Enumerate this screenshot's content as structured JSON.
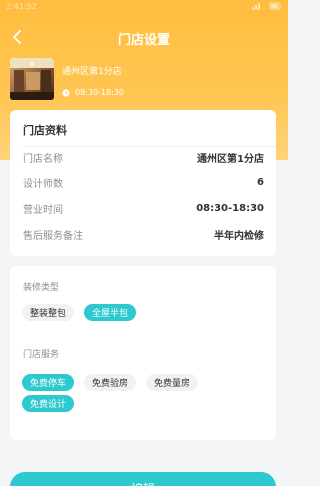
{
  "statusbar": {
    "time": "2:41:52",
    "icons": "signal-wifi-battery"
  },
  "header": {
    "title": "门店设置",
    "back_icon": "chevron-left-icon"
  },
  "store": {
    "name": "通州区第1分店",
    "hours": "08:30-18:30",
    "hours_icon": "clock-icon"
  },
  "info_card": {
    "title": "门店资料",
    "rows": [
      {
        "label": "门店名称",
        "value": "通州区第1分店"
      },
      {
        "label": "设计师数",
        "value": "6"
      },
      {
        "label": "营业时间",
        "value": "08:30-18:30"
      },
      {
        "label": "售后服务备注",
        "value": "半年内检修"
      }
    ]
  },
  "decoration": {
    "label": "装修类型",
    "options": [
      {
        "label": "整装整包",
        "selected": false
      },
      {
        "label": "全屋半包",
        "selected": true
      }
    ]
  },
  "services": {
    "label": "门店服务",
    "options": [
      {
        "label": "免费停车",
        "selected": true
      },
      {
        "label": "免费验房",
        "selected": false
      },
      {
        "label": "免费量房",
        "selected": false
      },
      {
        "label": "免费设计",
        "selected": true
      }
    ]
  },
  "bottom_button": {
    "label": "编辑"
  },
  "colors": {
    "accent": "#2ec8cf",
    "header": "#ffbd3f"
  }
}
